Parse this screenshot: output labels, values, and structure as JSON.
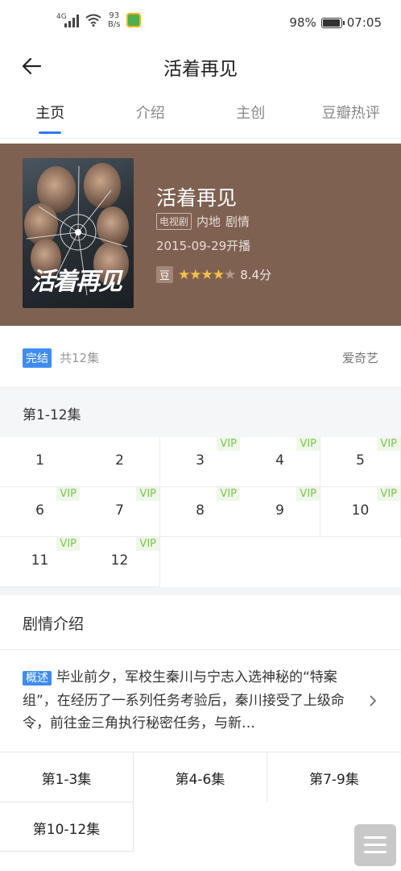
{
  "status_bar": {
    "network": "4G",
    "net_speed": "93",
    "net_unit": "B/s",
    "battery": "98%",
    "time": "07:05"
  },
  "header": {
    "title": "活着再见"
  },
  "tabs": [
    {
      "label": "主页",
      "active": true
    },
    {
      "label": "介绍",
      "active": false
    },
    {
      "label": "主创",
      "active": false
    },
    {
      "label": "豆瓣热评",
      "active": false
    }
  ],
  "show": {
    "poster_title": "活着再见",
    "title": "活着再见",
    "type_tag": "电视剧",
    "region": "内地",
    "genre": "剧情",
    "air_date": "2015-09-29开播",
    "douban_icon": "豆",
    "stars": 4,
    "score": "8.4分"
  },
  "episodes_info": {
    "status": "完结",
    "count": "共12集",
    "platform": "爱奇艺"
  },
  "episode_range": "第1-12集",
  "episodes": [
    {
      "num": "1",
      "vip": ""
    },
    {
      "num": "2",
      "vip": ""
    },
    {
      "num": "3",
      "vip": "VIP"
    },
    {
      "num": "4",
      "vip": "VIP"
    },
    {
      "num": "5",
      "vip": "VIP"
    },
    {
      "num": "6",
      "vip": "VIP"
    },
    {
      "num": "7",
      "vip": "VIP"
    },
    {
      "num": "8",
      "vip": "VIP"
    },
    {
      "num": "9",
      "vip": "VIP"
    },
    {
      "num": "10",
      "vip": "VIP"
    },
    {
      "num": "11",
      "vip": "VIP"
    },
    {
      "num": "12",
      "vip": "VIP"
    }
  ],
  "plot": {
    "heading": "剧情介绍",
    "tag": "概述",
    "text": "毕业前夕，军校生秦川与宁志入选神秘的“特案组”，在经历了一系列任务考验后，秦川接受了上级命令，前往金三角执行秘密任务，与新…"
  },
  "plot_ranges": [
    "第1-3集",
    "第4-6集",
    "第7-9集",
    "第10-12集"
  ],
  "colors": {
    "hero_bg": "#7e6151",
    "accent": "#2e7bff",
    "vip_text": "#7dc54e",
    "star": "#f3c146"
  }
}
